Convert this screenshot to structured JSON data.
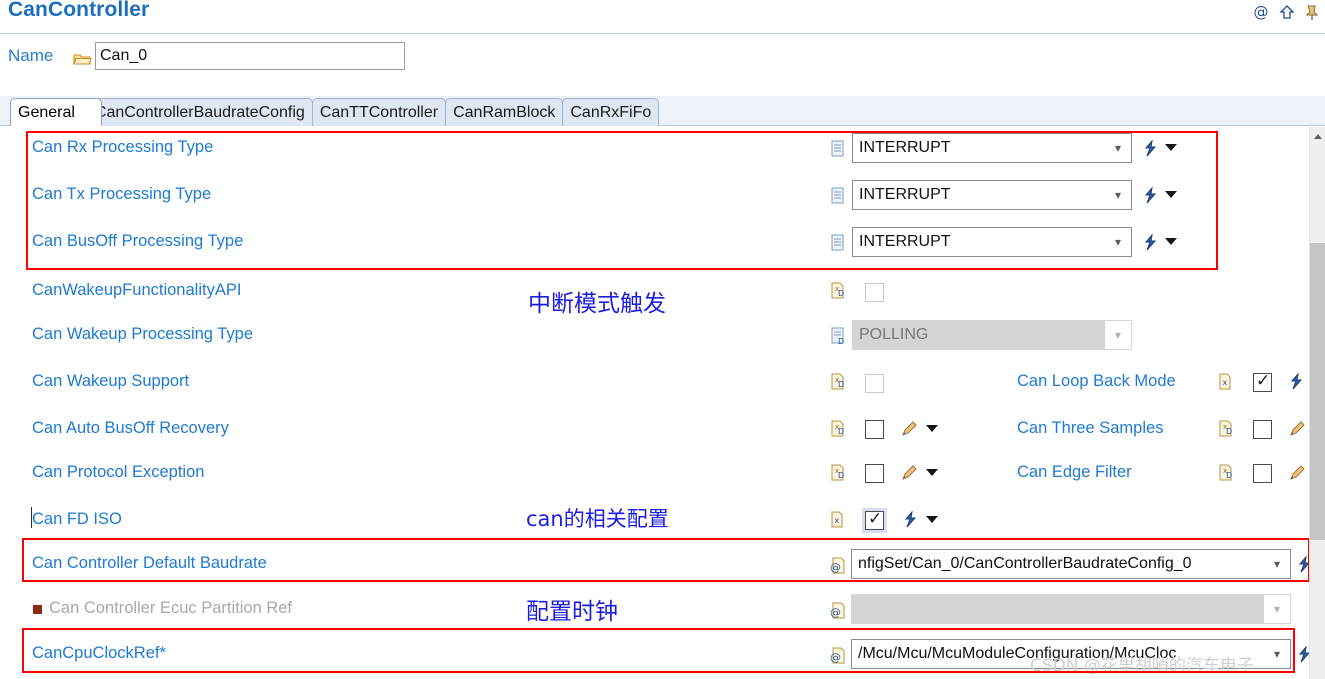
{
  "header": {
    "title": "CanController",
    "icons": [
      "at-icon",
      "home-up-icon",
      "pin-icon"
    ]
  },
  "name_row": {
    "label": "Name",
    "folder_icon": "open-folder-icon",
    "value": "Can_0"
  },
  "tabs": [
    {
      "label": "General",
      "active": true
    },
    {
      "label": "CanControllerBaudrateConfig",
      "active": false
    },
    {
      "label": "CanTTController",
      "active": false
    },
    {
      "label": "CanRamBlock",
      "active": false
    },
    {
      "label": "CanRxFiFo",
      "active": false
    }
  ],
  "rows": [
    {
      "label": "Can Rx Processing Type",
      "left_icon": "document-icon",
      "widget": "combo",
      "value": "INTERRUPT",
      "disabled": false,
      "trailing": [
        "flash-blue-icon",
        "dropdown-triangle-icon"
      ]
    },
    {
      "label": "Can Tx Processing Type",
      "left_icon": "document-icon",
      "widget": "combo",
      "value": "INTERRUPT",
      "disabled": false,
      "trailing": [
        "flash-blue-icon",
        "dropdown-triangle-icon"
      ]
    },
    {
      "label": "Can BusOff Processing Type",
      "left_icon": "document-icon",
      "widget": "combo",
      "value": "INTERRUPT",
      "disabled": false,
      "trailing": [
        "flash-blue-icon",
        "dropdown-triangle-icon"
      ]
    },
    {
      "label": "CanWakeupFunctionalityAPI",
      "left_icon": "document-xd-icon",
      "widget": "checkbox",
      "checked": false,
      "disabled": true,
      "trailing": []
    },
    {
      "label": "Can Wakeup Processing Type",
      "left_icon": "document-d-icon",
      "widget": "combo",
      "value": "POLLING",
      "disabled": true,
      "trailing": []
    },
    {
      "label": "Can Wakeup Support",
      "left_icon": "document-xd-icon",
      "widget": "checkbox",
      "checked": false,
      "disabled": true,
      "trailing": []
    },
    {
      "label": "Can Auto BusOff Recovery",
      "left_icon": "document-xd-icon",
      "widget": "checkbox",
      "checked": false,
      "disabled": false,
      "trailing": [
        "pencil-icon",
        "dropdown-triangle-icon"
      ]
    },
    {
      "label": "Can Protocol Exception",
      "left_icon": "document-xd-icon",
      "widget": "checkbox",
      "checked": false,
      "disabled": false,
      "trailing": [
        "pencil-icon",
        "dropdown-triangle-icon"
      ]
    },
    {
      "label": "Can FD ISO",
      "left_icon": "document-x-icon",
      "widget": "checkbox",
      "checked": true,
      "highlighted": true,
      "disabled": false,
      "trailing": [
        "flash-blue-icon",
        "dropdown-triangle-icon"
      ]
    },
    {
      "label": "Can Controller Default Baudrate",
      "left_icon": "at-document-icon",
      "widget": "combo-wide",
      "value": "nfigSet/Can_0/CanControllerBaudrateConfig_0",
      "disabled": false,
      "trailing": [
        "flash-blue-icon"
      ]
    },
    {
      "label": "Can Controller Ecuc Partition Ref",
      "left_icon": "at-document-icon",
      "widget": "combo-wide",
      "value": "",
      "disabled": true,
      "bullet": true,
      "trailing": []
    },
    {
      "label": "CanCpuClockRef*",
      "left_icon": "at-document-icon",
      "widget": "combo-wide",
      "value": "/Mcu/Mcu/McuModuleConfiguration/McuCloc",
      "disabled": false,
      "trailing": [
        "flash-blue-icon"
      ]
    }
  ],
  "right_column": [
    {
      "label": "Can Loop Back Mode",
      "left_icon": "document-x-icon",
      "checked": true,
      "trailing": [
        "flash-blue-icon"
      ]
    },
    {
      "label": "Can Three Samples",
      "left_icon": "document-xd-icon",
      "checked": false,
      "trailing": [
        "pencil-icon"
      ]
    },
    {
      "label": "Can Edge Filter",
      "left_icon": "document-xd-icon",
      "checked": false,
      "trailing": [
        "pencil-icon"
      ]
    }
  ],
  "annotations": {
    "note_interrupt_mode": "中断模式触发",
    "note_can_config": "can的相关配置",
    "note_clock_config": "配置时钟"
  },
  "watermark": "CSDN @花里胡哨的汽车电子",
  "colors": {
    "title_blue": "#1b6ec2",
    "label_blue": "#1e7ad4",
    "annotation_red": "#ff0000",
    "note_blue": "#1d1de0",
    "disabled_grey": "#a9a9a9"
  }
}
